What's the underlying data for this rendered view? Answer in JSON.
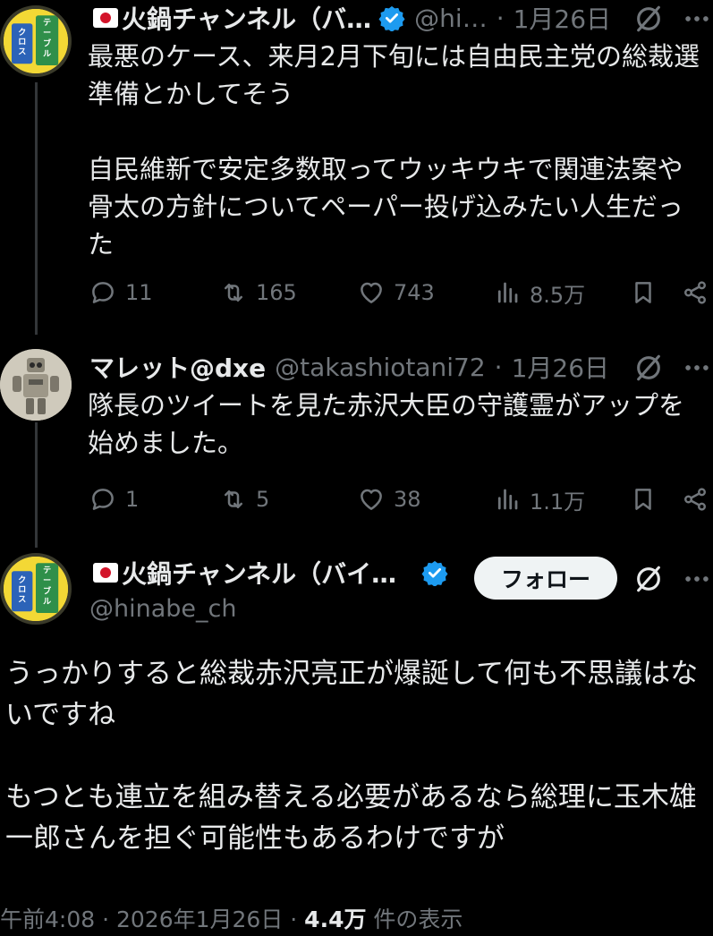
{
  "posts": [
    {
      "display_name": "火鍋チャンネル（バ…",
      "handle": "@hi…",
      "time": "1月26日",
      "text": "最悪のケース、来月2月下旬には自由民主党の総裁選準備とかしてそう\n\n自民維新で安定多数取ってウッキウキで関連法案や骨太の方針についてペーパー投げ込みたい人生だった",
      "replies": "11",
      "reposts": "165",
      "likes": "743",
      "views": "8.5万"
    },
    {
      "display_name": "マレット@dxe",
      "handle": "@takashiotani72",
      "time": "1月26日",
      "text": "隊長のツイートを見た赤沢大臣の守護霊がアップを始めました。",
      "replies": "1",
      "reposts": "5",
      "likes": "38",
      "views": "1.1万"
    }
  ],
  "main_post": {
    "display_name": "火鍋チャンネル（バイ…",
    "handle": "@hinabe_ch",
    "follow_label": "フォロー",
    "text": "うっかりすると総裁赤沢亮正が爆誕して何も不思議はないですね\n\nもつとも連立を組み替える必要があるなら総理に玉木雄一郎さんを担ぐ可能性もあるわけですが",
    "timestamp": "午前4:08 · 2026年1月26日 · ",
    "views": "4.4万",
    "views_suffix": " 件の表示"
  },
  "separator": "·",
  "avatar_text": "テーブルクロス",
  "colors": {
    "background": "#000000",
    "text": "#e7e9ea",
    "muted": "#71767b",
    "verified": "#1d9bf0",
    "follow_bg": "#eff3f4"
  },
  "icons": [
    "japan-flag-icon",
    "verified-badge-icon",
    "grok-icon",
    "more-icon",
    "reply-icon",
    "repost-icon",
    "like-icon",
    "views-icon",
    "bookmark-icon",
    "share-icon"
  ]
}
